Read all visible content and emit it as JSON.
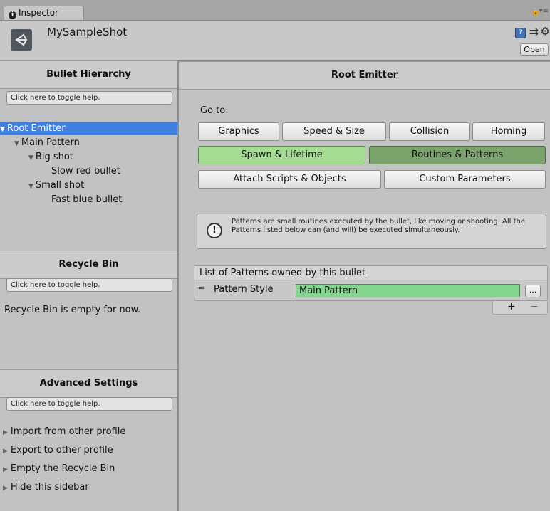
{
  "window": {
    "tab_label": "Inspector",
    "object_name": "MySampleShot",
    "open_label": "Open",
    "icons": [
      "info-icon",
      "lock-icon",
      "menu-icon",
      "unity-logo-icon",
      "book-icon",
      "sliders-icon",
      "gear-icon"
    ]
  },
  "sidebar": {
    "hierarchy_title": "Bullet Hierarchy",
    "help_toggle": "Click here to toggle help.",
    "tree": [
      {
        "label": "Root Emitter",
        "arrow": "▼",
        "indent": 0,
        "selected": true
      },
      {
        "label": "Main Pattern",
        "arrow": "▼",
        "indent": 1,
        "selected": false
      },
      {
        "label": "Big shot",
        "arrow": "▼",
        "indent": 2,
        "selected": false
      },
      {
        "label": "Slow red bullet",
        "arrow": "",
        "indent": 3,
        "selected": false
      },
      {
        "label": "Small shot",
        "arrow": "▼",
        "indent": 2,
        "selected": false
      },
      {
        "label": "Fast blue bullet",
        "arrow": "",
        "indent": 3,
        "selected": false
      }
    ],
    "recycle_title": "Recycle Bin",
    "recycle_empty": "Recycle Bin is empty for now.",
    "advanced_title": "Advanced Settings",
    "advanced_items": [
      "Import from other profile",
      "Export to other profile",
      "Empty the Recycle Bin",
      "Hide this sidebar"
    ]
  },
  "main": {
    "title": "Root Emitter",
    "goto_label": "Go to:",
    "nav_buttons": {
      "graphics": "Graphics",
      "speed_size": "Speed & Size",
      "collision": "Collision",
      "homing": "Homing",
      "spawn_lifetime": "Spawn & Lifetime",
      "routines_patterns": "Routines & Patterns",
      "attach_scripts": "Attach Scripts & Objects",
      "custom_params": "Custom Parameters"
    },
    "info_text": "Patterns are small routines executed by the bullet, like moving or shooting. All the Patterns listed below can (and will) be executed simultaneously.",
    "list_title": "List of Patterns owned by this bullet",
    "pattern_label": "Pattern Style",
    "pattern_value": "Main Pattern",
    "dots_label": "...",
    "plus_label": "+",
    "minus_label": "−"
  },
  "colors": {
    "selection": "#3d80df",
    "green_light": "#a4dd92",
    "green_dark": "#7aa46c",
    "pattern_field": "#84d58f"
  }
}
